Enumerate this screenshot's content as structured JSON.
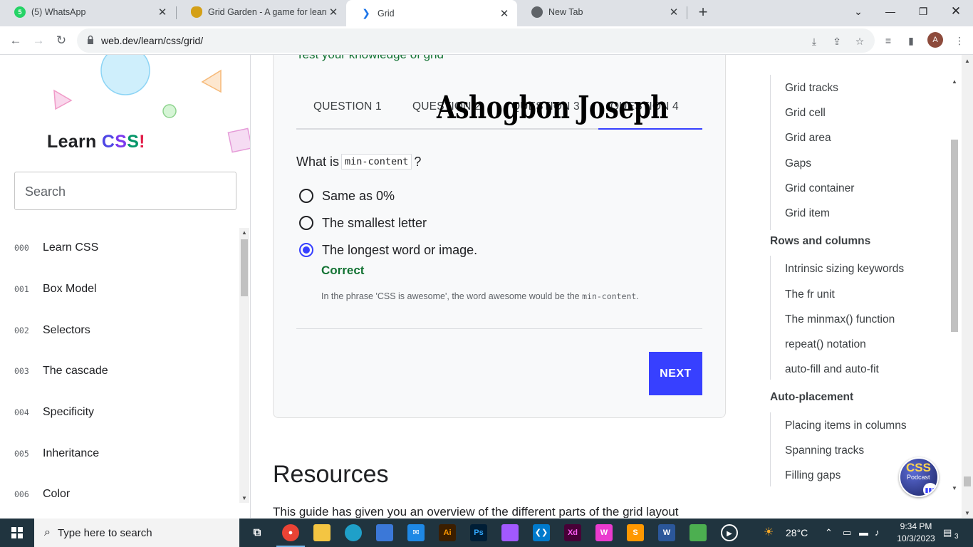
{
  "browser": {
    "tabs": [
      {
        "title": "(5) WhatsApp",
        "icon": "whatsapp-icon"
      },
      {
        "title": "Grid Garden - A game for learnin",
        "icon": "grid-garden-icon"
      },
      {
        "title": "Grid",
        "icon": "webdev-icon",
        "active": true
      },
      {
        "title": "New Tab",
        "icon": "chrome-icon"
      }
    ],
    "url": "web.dev/learn/css/grid/",
    "profile_initial": "A"
  },
  "sidebar": {
    "logo_prefix": "Learn",
    "logo_c": "C",
    "logo_s1": "S",
    "logo_s2": "S",
    "logo_bang": "!",
    "search_placeholder": "Search",
    "items": [
      {
        "num": "000",
        "label": "Learn CSS"
      },
      {
        "num": "001",
        "label": "Box Model"
      },
      {
        "num": "002",
        "label": "Selectors"
      },
      {
        "num": "003",
        "label": "The cascade"
      },
      {
        "num": "004",
        "label": "Specificity"
      },
      {
        "num": "005",
        "label": "Inheritance"
      },
      {
        "num": "006",
        "label": "Color"
      }
    ]
  },
  "assessment": {
    "heading_partial": "Test your knowledge of grid",
    "tabs": [
      "QUESTION 1",
      "QUESTION 2",
      "QUESTION 3",
      "QUESTION 4"
    ],
    "watermark": "Ashogbon Joseph",
    "question_prefix": "What is",
    "question_code": "min-content",
    "question_suffix": "?",
    "options": [
      {
        "label": "Same as 0%",
        "checked": false
      },
      {
        "label": "The smallest letter",
        "checked": false
      },
      {
        "label": "The longest word or image.",
        "checked": true
      }
    ],
    "result": "Correct",
    "explanation_prefix": "In the phrase 'CSS is awesome', the word awesome would be the",
    "explanation_code": "min-content",
    "explanation_suffix": ".",
    "next_label": "NEXT"
  },
  "resources": {
    "heading": "Resources",
    "body": "This guide has given you an overview of the different parts of the grid layout"
  },
  "toc": {
    "items_top": [
      "Grid tracks",
      "Grid cell",
      "Grid area",
      "Gaps",
      "Grid container",
      "Grid item"
    ],
    "group_rows": "Rows and columns",
    "items_rows": [
      "Intrinsic sizing keywords",
      "The fr unit",
      "The minmax() function",
      "repeat() notation",
      "auto-fill and auto-fit"
    ],
    "group_auto": "Auto-placement",
    "items_auto": [
      "Placing items in columns",
      "Spanning tracks",
      "Filling gaps"
    ]
  },
  "podcast": {
    "title": "CSS",
    "subtitle": "Podcast"
  },
  "taskbar": {
    "search_placeholder": "Type here to search",
    "weather": "28°C",
    "time": "9:34 PM",
    "date": "10/3/2023",
    "notifications": "3"
  },
  "colors": {
    "accent": "#3740ff",
    "correct": "#137333",
    "taskbar": "#20343f"
  }
}
